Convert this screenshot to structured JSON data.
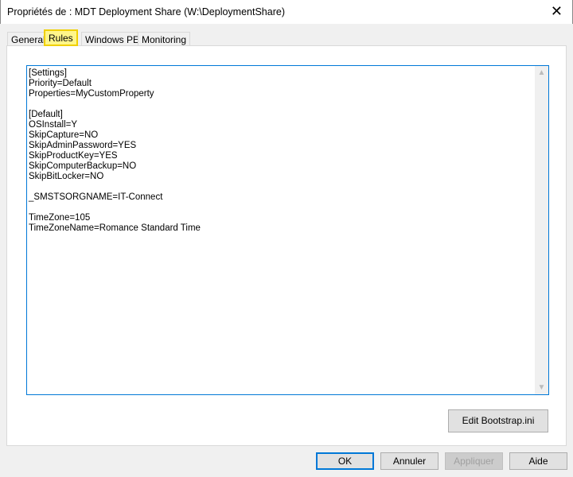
{
  "window": {
    "title": "Propriétés de : MDT Deployment Share (W:\\DeploymentShare)",
    "close": "✕"
  },
  "tabs": [
    {
      "label": "General"
    },
    {
      "label": "Rules",
      "active": true
    },
    {
      "label": "Windows PE"
    },
    {
      "label": "Monitoring"
    }
  ],
  "rules_text": "[Settings]\nPriority=Default\nProperties=MyCustomProperty\n\n[Default]\nOSInstall=Y\nSkipCapture=NO\nSkipAdminPassword=YES\nSkipProductKey=YES\nSkipComputerBackup=NO\nSkipBitLocker=NO\n\n_SMSTSORGNAME=IT-Connect\n\nTimeZone=105\nTimeZoneName=Romance Standard Time",
  "buttons": {
    "edit_bootstrap": "Edit Bootstrap.ini",
    "ok": "OK",
    "cancel": "Annuler",
    "apply": "Appliquer",
    "help": "Aide"
  },
  "colors": {
    "focus": "#0078d7",
    "highlight": "#fff68a"
  }
}
